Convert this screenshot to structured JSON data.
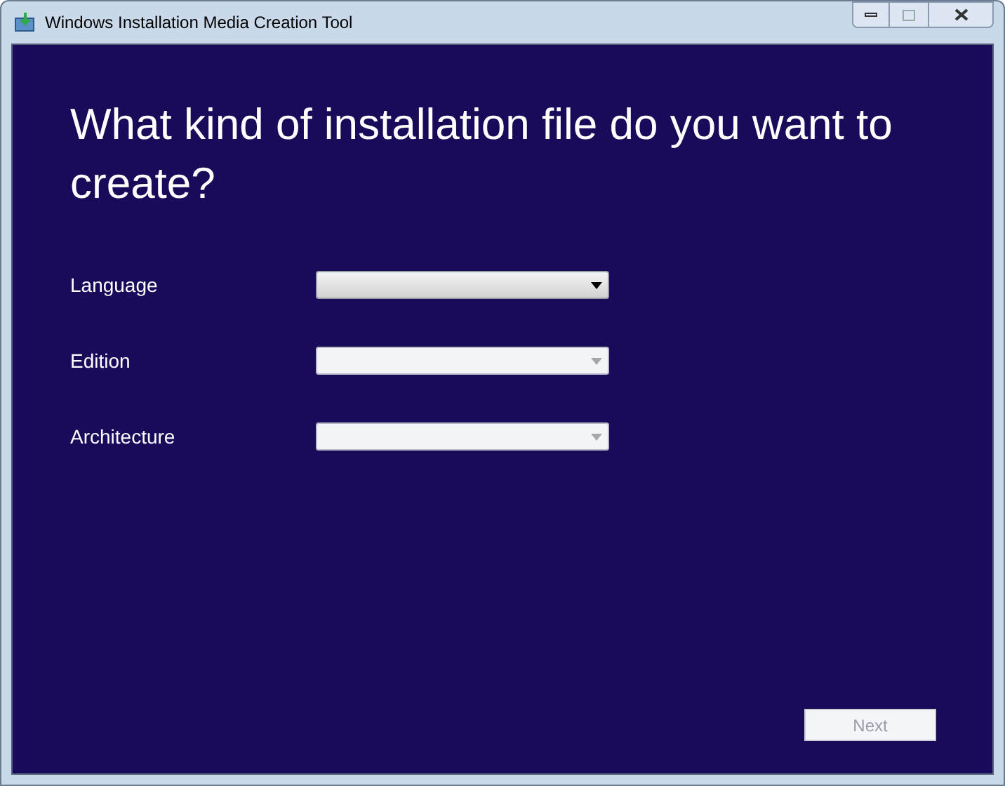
{
  "window": {
    "title": "Windows Installation Media Creation Tool"
  },
  "heading": "What kind of installation file do you want to create?",
  "fields": [
    {
      "label": "Language",
      "disabled": false
    },
    {
      "label": "Edition",
      "disabled": true
    },
    {
      "label": "Architecture",
      "disabled": true
    }
  ],
  "next_button": {
    "label": "Next",
    "disabled": true
  }
}
